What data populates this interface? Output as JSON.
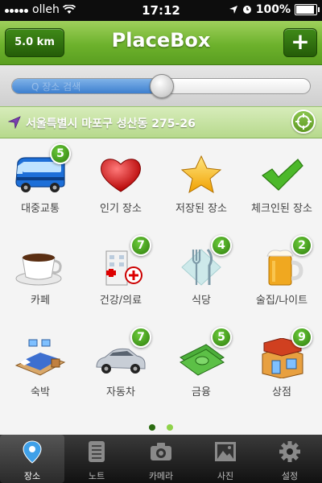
{
  "status": {
    "carrier": "olleh",
    "time": "17:12",
    "battery": "100%",
    "battery_level": 1.0
  },
  "header": {
    "distance": "5.0 km",
    "title": "PlaceBox",
    "add_label": "+"
  },
  "radius_slider": {
    "value": 0.5,
    "placeholder": "Q 장소 검색"
  },
  "location": {
    "address": "서울특별시 마포구 성산동 275-26"
  },
  "categories": [
    {
      "label": "대중교통",
      "icon": "bus-icon",
      "badge": "5"
    },
    {
      "label": "인기 장소",
      "icon": "heart-icon",
      "badge": ""
    },
    {
      "label": "저장된 장소",
      "icon": "star-icon",
      "badge": ""
    },
    {
      "label": "체크인된 장소",
      "icon": "checkmark-icon",
      "badge": ""
    },
    {
      "label": "카페",
      "icon": "coffee-cup-icon",
      "badge": ""
    },
    {
      "label": "건강/의료",
      "icon": "hospital-icon",
      "badge": "7"
    },
    {
      "label": "식당",
      "icon": "fork-knife-icon",
      "badge": "4"
    },
    {
      "label": "술집/나이트",
      "icon": "beer-mug-icon",
      "badge": "2"
    },
    {
      "label": "숙박",
      "icon": "bed-icon",
      "badge": ""
    },
    {
      "label": "자동차",
      "icon": "car-icon",
      "badge": "7"
    },
    {
      "label": "금융",
      "icon": "money-icon",
      "badge": "5"
    },
    {
      "label": "상점",
      "icon": "shop-icon",
      "badge": "9"
    }
  ],
  "pager": {
    "pages": 2,
    "current": 0
  },
  "tabs": [
    {
      "label": "장소",
      "icon": "location-pin-icon",
      "active": true
    },
    {
      "label": "노트",
      "icon": "notes-icon",
      "active": false
    },
    {
      "label": "카메라",
      "icon": "camera-icon",
      "active": false
    },
    {
      "label": "사진",
      "icon": "photo-icon",
      "active": false
    },
    {
      "label": "설정",
      "icon": "gear-icon",
      "active": false
    }
  ],
  "colors": {
    "header_green": "#6db22c",
    "badge_green": "#3a8f14",
    "pager_active": "#2a6b10",
    "pager_inactive": "#8fd24a"
  }
}
